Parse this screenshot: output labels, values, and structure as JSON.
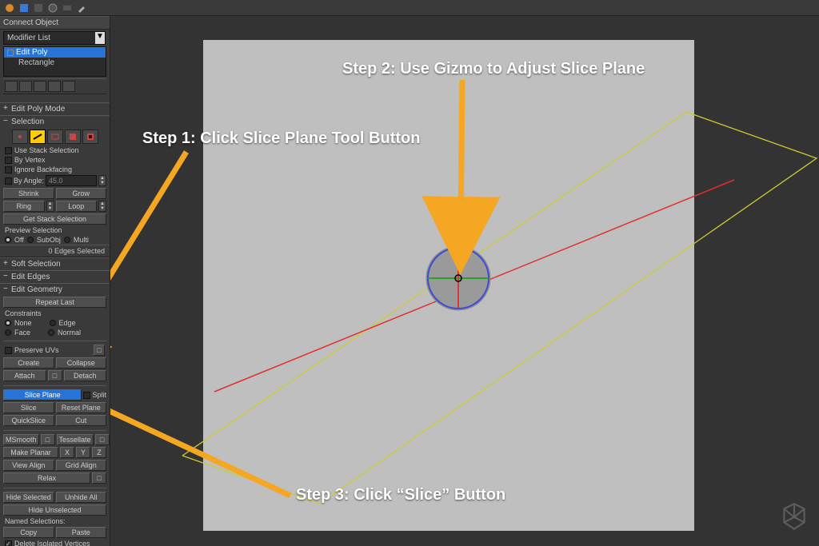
{
  "toolbar": {
    "title": "Connect Object"
  },
  "modifier_list_label": "Modifier List",
  "stack": {
    "items": [
      {
        "label": "Edit Poly",
        "selected": true
      },
      {
        "label": "Rectangle",
        "selected": false
      }
    ]
  },
  "rollouts": {
    "edit_poly_mode": "Edit Poly Mode",
    "selection": "Selection",
    "soft_selection": "Soft Selection",
    "edit_edges": "Edit Edges",
    "edit_geometry": "Edit Geometry"
  },
  "selection": {
    "use_stack": "Use Stack Selection",
    "by_vertex": "By Vertex",
    "ignore_backfacing": "Ignore Backfacing",
    "by_angle": "By Angle:",
    "angle_value": "45.0",
    "shrink": "Shrink",
    "grow": "Grow",
    "ring": "Ring",
    "loop": "Loop",
    "get_stack": "Get Stack Selection",
    "preview_label": "Preview Selection",
    "off": "Off",
    "subobj": "SubObj",
    "multi": "Multi",
    "status": "0 Edges Selected"
  },
  "geometry": {
    "repeat_last": "Repeat Last",
    "constraints": "Constraints",
    "none": "None",
    "edge": "Edge",
    "face": "Face",
    "normal": "Normal",
    "preserve_uvs": "Preserve UVs",
    "create": "Create",
    "collapse": "Collapse",
    "attach": "Attach",
    "detach": "Detach",
    "slice_plane": "Slice Plane",
    "split": "Split",
    "slice": "Slice",
    "reset_plane": "Reset Plane",
    "quickslice": "QuickSlice",
    "cut": "Cut",
    "msmooth": "MSmooth",
    "tessellate": "Tessellate",
    "make_planar": "Make Planar",
    "x": "X",
    "y": "Y",
    "z": "Z",
    "view_align": "View Align",
    "grid_align": "Grid Align",
    "relax": "Relax",
    "hide_selected": "Hide Selected",
    "unhide_all": "Unhide All",
    "hide_unselected": "Hide Unselected",
    "named_selections": "Named Selections:",
    "copy": "Copy",
    "paste": "Paste",
    "delete_isolated": "Delete Isolated Vertices"
  },
  "annotations": {
    "step1": "Step 1: Click Slice Plane Tool Button",
    "step2": "Step 2: Use Gizmo to Adjust Slice Plane",
    "step3": "Step 3: Click “Slice” Button"
  }
}
